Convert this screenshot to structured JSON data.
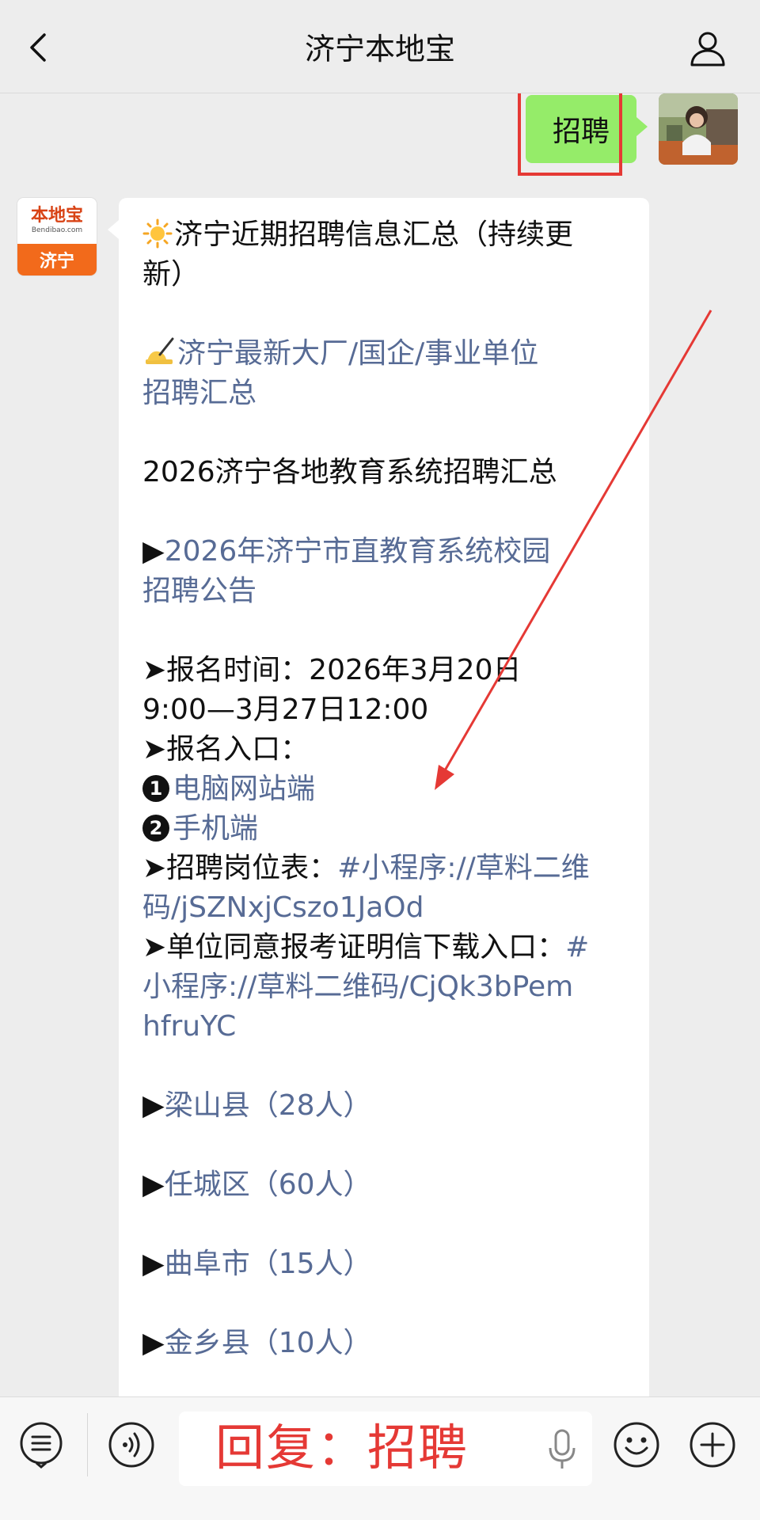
{
  "header": {
    "title": "济宁本地宝",
    "back_icon": "chevron-left-icon",
    "profile_icon": "person-icon"
  },
  "chat": {
    "user_message": "招聘",
    "bot_avatar": {
      "logo": "本地宝",
      "sub": "Bendibao.com",
      "city": "济宁"
    },
    "bot_lines": {
      "l1": "济宁近期招聘信息汇总（持续更",
      "l2": "新）",
      "l3": "济宁最新大厂/国企/事业单位",
      "l4": "招聘汇总",
      "l5": "2026济宁各地教育系统招聘汇总",
      "l6_prefix": "▶",
      "l6": "2026年济宁市直教育系统校园",
      "l7": "招聘公告",
      "l8": "➤报名时间：2026年3月20日",
      "l9": "9:00—3月27日12:00",
      "l10": "➤报名入口：",
      "l11_num": "1",
      "l11": "电脑网站端",
      "l12_num": "2",
      "l12": "手机端",
      "l13_prefix": "➤招聘岗位表：",
      "l13": "#小程序://草料二维",
      "l14": "码/jSZNxjCszo1JaOd",
      "l15_prefix": "➤单位同意报考证明信下载入口：",
      "l15": "#",
      "l16": "小程序://草料二维码/CjQk3bPem",
      "l17": "hfruYC",
      "l18_prefix": "▶",
      "l18": "梁山县（28人）",
      "l19_prefix": "▶",
      "l19": "任城区（60人）",
      "l20_prefix": "▶",
      "l20": "曲阜市（15人）",
      "l21_prefix": "▶",
      "l21": "金乡县（10人）"
    }
  },
  "input_bar": {
    "hint": "回复：招聘",
    "menu_icon": "list-menu-icon",
    "voice_icon": "voice-icon",
    "mic_icon": "microphone-icon",
    "emoji_icon": "emoji-icon",
    "plus_icon": "plus-icon"
  },
  "colors": {
    "link": "#576b95",
    "user_bubble": "#95ec69",
    "annotation": "#e53935",
    "background": "#ededed"
  }
}
